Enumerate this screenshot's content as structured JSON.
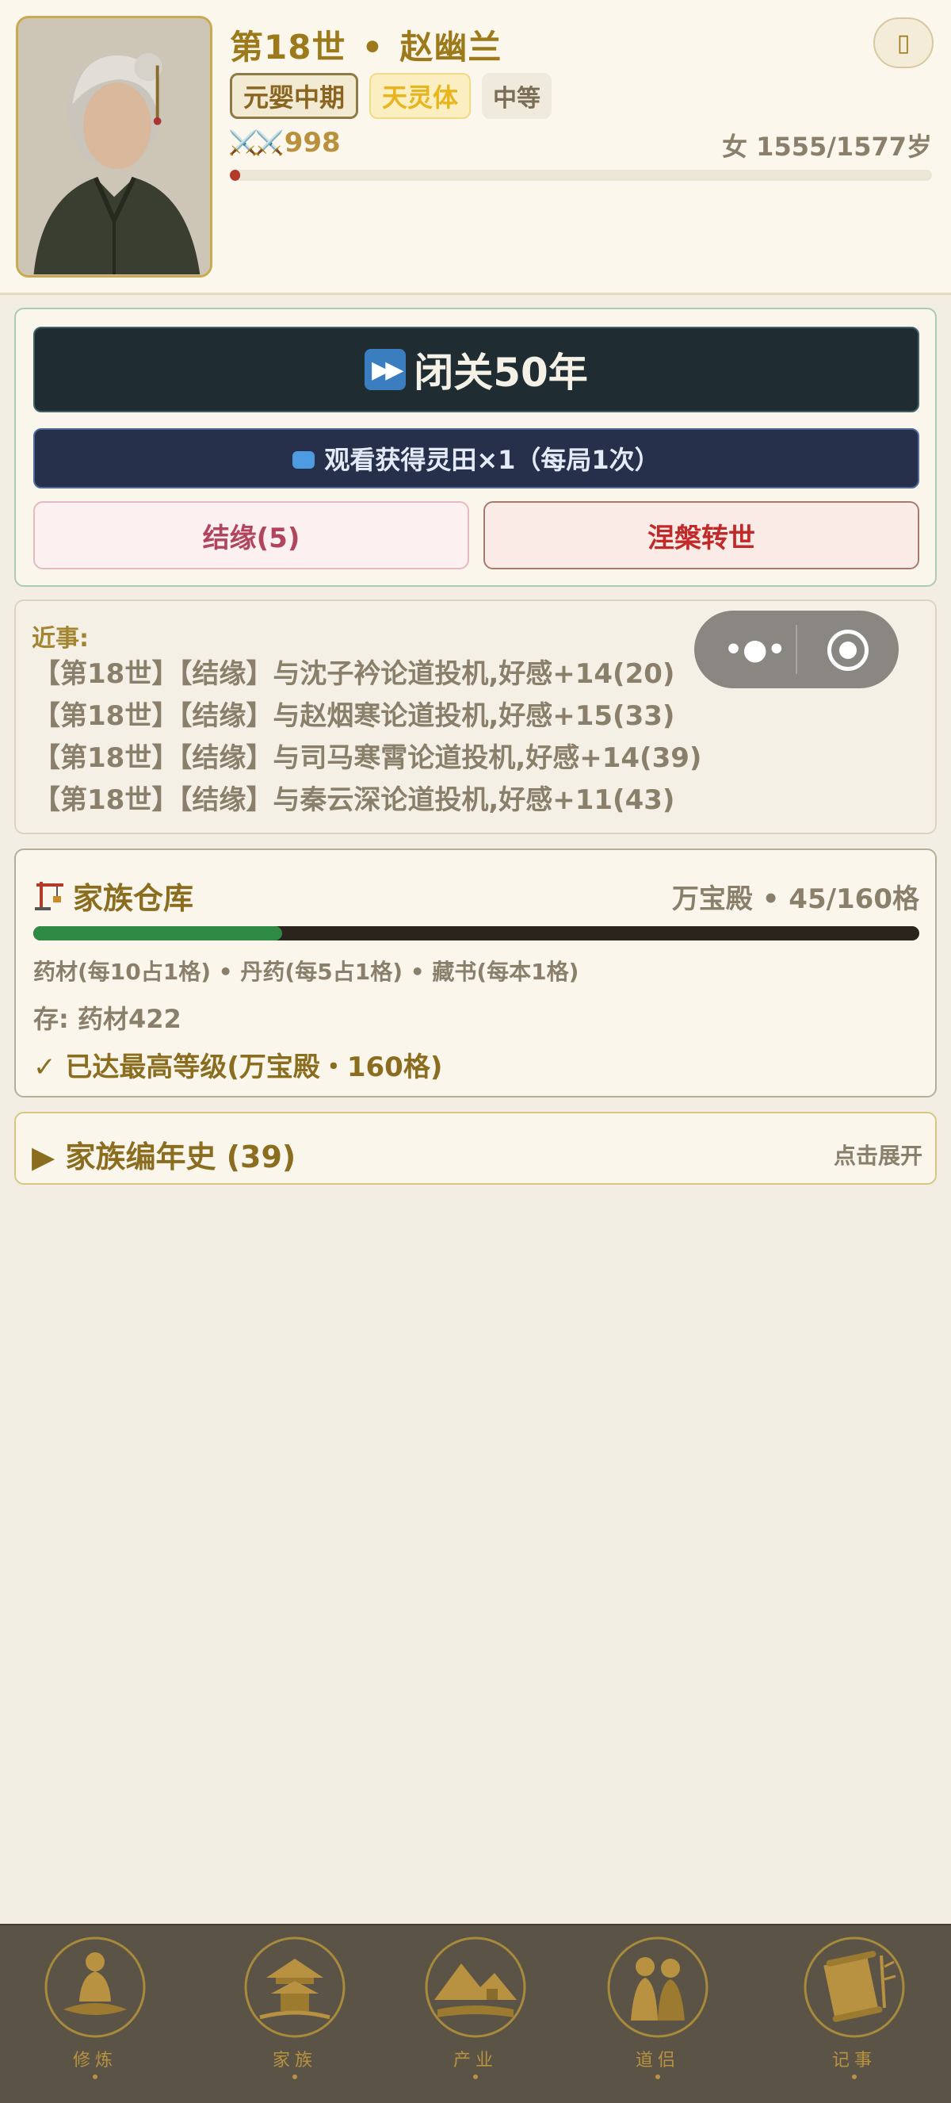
{
  "header": {
    "generation": "第18世",
    "separator": "•",
    "name": "赵幽兰",
    "tags": {
      "realm": "元婴中期",
      "body": "天灵体",
      "grade": "中等"
    },
    "power_icon": "crossed-swords-icon",
    "power": "998",
    "age": "女 1555/1577岁",
    "life_remaining_fraction": 0.015,
    "corner_button_icon": "menu-icon"
  },
  "actions": {
    "retreat_label": "闭关50年",
    "retreat_icon": "fast-forward-icon",
    "ad_label": "观看获得灵田×1（每局1次）",
    "ad_icon": "tv-icon",
    "bond_label": "结缘(5)",
    "rebirth_label": "涅槃转世"
  },
  "recent": {
    "title": "近事:",
    "items": [
      "【第18世】【结缘】与沈子衿论道投机,好感+14(20)",
      "【第18世】【结缘】与赵烟寒论道投机,好感+15(33)",
      "【第18世】【结缘】与司马寒霄论道投机,好感+14(39)",
      "【第18世】【结缘】与秦云深论道投机,好感+11(43)"
    ]
  },
  "warehouse": {
    "icon": "crane-icon",
    "title": "家族仓库",
    "capacity": "万宝殿 • 45/160格",
    "used": 45,
    "total": 160,
    "rules": "药材(每10占1格) • 丹药(每5占1格) • 藏书(每本1格)",
    "stored": "存: 药材422",
    "max_level": "✓ 已达最高等级(万宝殿・160格)"
  },
  "chronicle": {
    "title": "▶ 家族编年史 (39)",
    "hint": "点击展开"
  },
  "nav": [
    {
      "label": "修炼",
      "icon": "meditation-icon"
    },
    {
      "label": "家族",
      "icon": "pavilion-icon"
    },
    {
      "label": "产业",
      "icon": "mountain-icon"
    },
    {
      "label": "道侣",
      "icon": "couple-icon"
    },
    {
      "label": "记事",
      "icon": "scroll-icon"
    }
  ],
  "colors": {
    "accent_gold": "#9c7a1c",
    "dark_button": "#1f2d33",
    "ad_button": "#26304a",
    "bond_text": "#b1455d",
    "rebirth_text": "#c22a2a",
    "progress_green": "#2f8a45"
  }
}
